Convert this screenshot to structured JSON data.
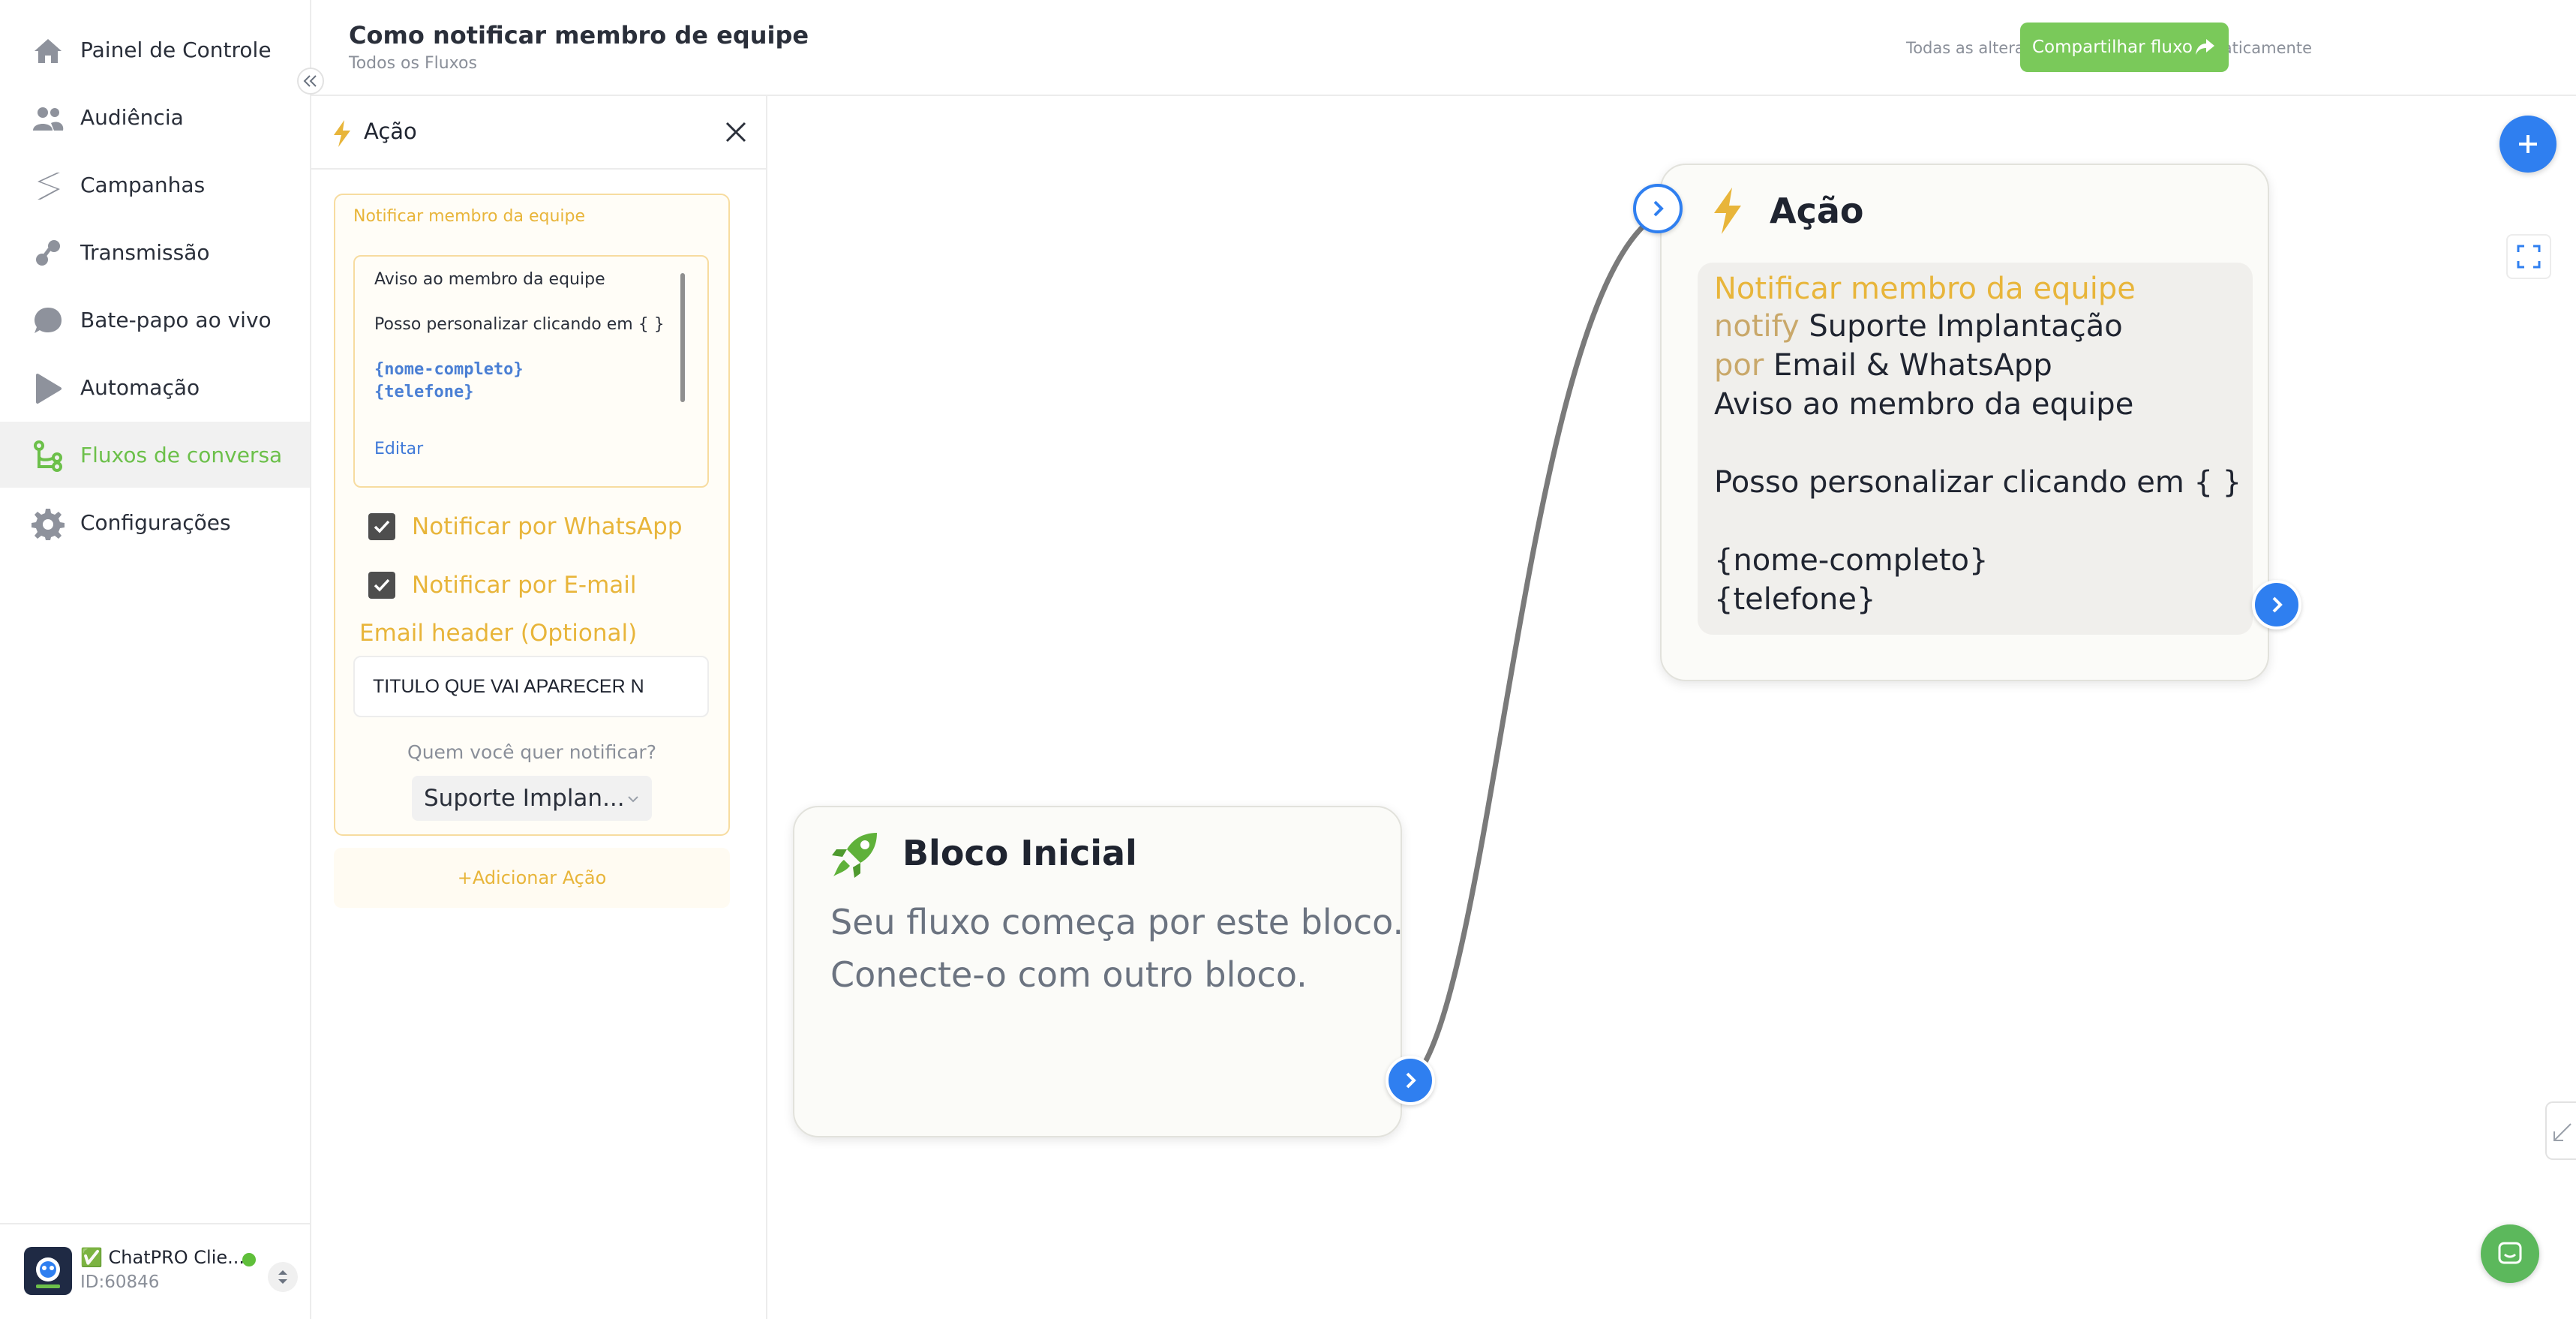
{
  "sidebar": {
    "items": [
      {
        "label": "Painel de Controle",
        "icon": "home-icon"
      },
      {
        "label": "Audiência",
        "icon": "users-icon"
      },
      {
        "label": "Campanhas",
        "icon": "campaign-icon"
      },
      {
        "label": "Transmissão",
        "icon": "broadcast-icon"
      },
      {
        "label": "Bate-papo ao vivo",
        "icon": "chat-bubble-icon"
      },
      {
        "label": "Automação",
        "icon": "automation-icon"
      },
      {
        "label": "Fluxos de conversa",
        "icon": "flow-icon",
        "active": true
      },
      {
        "label": "Configurações",
        "icon": "gear-icon"
      }
    ],
    "account": {
      "name": "✅ ChatPRO Clie...",
      "id": "ID:60846",
      "status": "online"
    }
  },
  "header": {
    "title": "Como notificar membro de equipe",
    "breadcrumb": "Todos os Fluxos",
    "autosave": "Todas as alterações foram salvas automaticamente",
    "share_label": "Compartilhar fluxo"
  },
  "panel": {
    "title": "Ação",
    "card_heading": "Notificar membro da equipe",
    "message": {
      "line1": "Aviso ao membro da equipe",
      "line2": "Posso personalizar clicando em { }",
      "var1": "{nome-completo}",
      "var2": "{telefone}",
      "edit_label": "Editar"
    },
    "whatsapp_label": "Notificar por WhatsApp",
    "whatsapp_checked": true,
    "email_label": "Notificar por E-mail",
    "email_checked": true,
    "email_header_label": "Email header (Optional)",
    "email_header_value": "TITULO QUE VAI APARECER N",
    "notify_question": "Quem você quer notificar?",
    "recipient": "Suporte Implan...",
    "add_action": "+Adicionar Ação"
  },
  "canvas": {
    "start_node": {
      "title": "Bloco Inicial",
      "body_line1": "Seu fluxo começa por este bloco.",
      "body_line2": "Conecte-o com outro bloco."
    },
    "action_node": {
      "title": "Ação",
      "heading": "Notificar membro da equipe",
      "notify_prefix": "notify",
      "notify_target": "Suporte Implantação",
      "via_prefix": "por",
      "via_channels": "Email & WhatsApp",
      "line_message": "Aviso ao membro da equipe",
      "line_personalize": "Posso personalizar clicando em { }",
      "var1": "{nome-completo}",
      "var2": "{telefone}"
    }
  },
  "colors": {
    "brand_green": "#7ac95a",
    "accent_gold": "#e8b53a",
    "port_blue": "#2f7ff0"
  }
}
